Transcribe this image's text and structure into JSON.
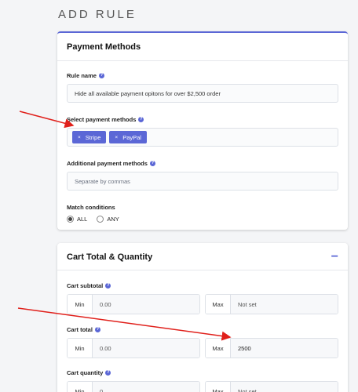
{
  "page": {
    "title": "ADD RULE"
  },
  "payment_methods": {
    "title": "Payment Methods",
    "rule_name": {
      "label": "Rule name",
      "value": "Hide all available payment opitons for over $2,500 order"
    },
    "select_methods": {
      "label": "Select payment methods",
      "tags": [
        "Stripe",
        "PayPal"
      ],
      "remove_glyph": "×"
    },
    "additional": {
      "label": "Additional payment methods",
      "placeholder": "Separate by commas"
    },
    "match": {
      "label": "Match conditions",
      "options": [
        "ALL",
        "ANY"
      ],
      "selected": "ALL"
    }
  },
  "cart": {
    "title": "Cart Total & Quantity",
    "collapse_glyph": "−",
    "subtotal": {
      "label": "Cart subtotal",
      "min_label": "Min",
      "min_value": "0.00",
      "max_label": "Max",
      "max_value": "Not set"
    },
    "total": {
      "label": "Cart total",
      "min_label": "Min",
      "min_value": "0.00",
      "max_label": "Max",
      "max_value": "2500"
    },
    "quantity": {
      "label": "Cart quantity",
      "min_label": "Min",
      "min_value": "0",
      "max_label": "Max",
      "max_value": "Not set"
    }
  },
  "help_glyph": "?",
  "colors": {
    "accent": "#5b67d6",
    "annotation_arrow": "#e0201b"
  }
}
